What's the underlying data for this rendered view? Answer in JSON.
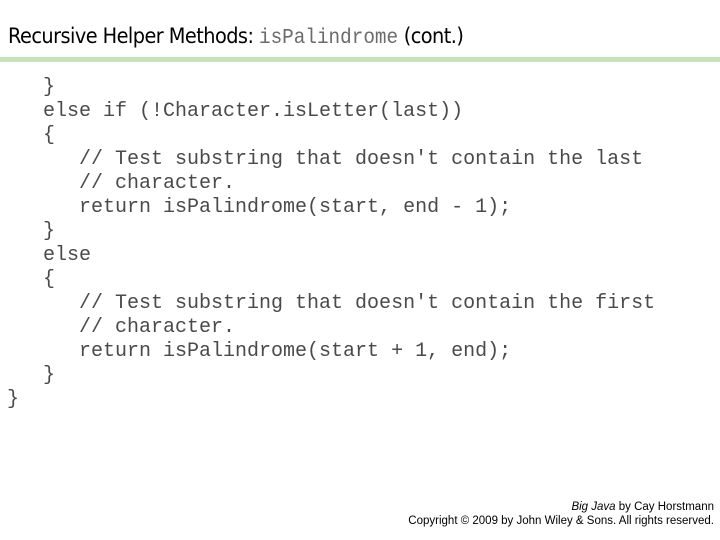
{
  "slide": {
    "title": {
      "prefix": "Recursive Helper Methods: ",
      "code": "isPalindrome",
      "suffix": " (cont.)"
    },
    "accent_rule_color": "#c9e3b8",
    "code_lines": [
      "   }",
      "   else if (!Character.isLetter(last))",
      "   {",
      "      // Test substring that doesn't contain the last",
      "      // character.",
      "      return isPalindrome(start, end - 1);",
      "   }",
      "   else",
      "   {",
      "      // Test substring that doesn't contain the first",
      "      // character.",
      "      return isPalindrome(start + 1, end);",
      "   }",
      "}"
    ],
    "footer": {
      "book_title": "Big Java",
      "byline": " by Cay Horstmann",
      "copyright": "Copyright © 2009 by John Wiley & Sons.  All rights reserved."
    }
  }
}
